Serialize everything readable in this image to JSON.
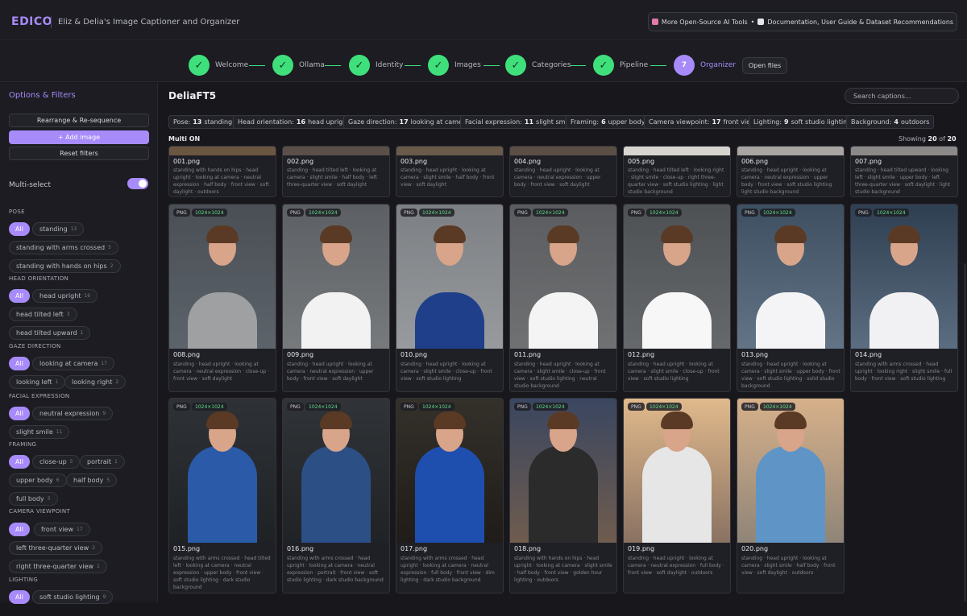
{
  "app": {
    "brand": "EDICO",
    "subtitle": "Eliz & Delia's Image Captioner and Organizer"
  },
  "top_link": {
    "part1": "More Open-Source AI Tools",
    "sep": "•",
    "part2": "Documentation, User Guide & Dataset Recommendations"
  },
  "steps": [
    {
      "label": "Welcome",
      "mark": "✓"
    },
    {
      "label": "Ollama",
      "mark": "✓"
    },
    {
      "label": "Identity",
      "mark": "✓"
    },
    {
      "label": "Images",
      "mark": "✓"
    },
    {
      "label": "Categories",
      "mark": "✓"
    },
    {
      "label": "Pipeline",
      "mark": "✓"
    },
    {
      "label": "Organizer",
      "mark": "7"
    }
  ],
  "open_files": "Open files",
  "sidebar": {
    "title": "Options & Filters",
    "rearrange": "Rearrange & Re-sequence",
    "add_image": "+ Add image",
    "reset": "Reset filters",
    "multiselect": "Multi-select",
    "sections": [
      {
        "title": "POSE",
        "chips": [
          {
            "label": "All"
          },
          {
            "label": "standing",
            "count": "13"
          },
          {
            "label": "standing with arms crossed",
            "count": "5"
          },
          {
            "label": "standing with hands on hips",
            "count": "2"
          }
        ]
      },
      {
        "title": "HEAD ORIENTATION",
        "chips": [
          {
            "label": "All"
          },
          {
            "label": "head upright",
            "count": "16"
          },
          {
            "label": "head tilted left",
            "count": "3"
          },
          {
            "label": "head tilted upward",
            "count": "1"
          }
        ]
      },
      {
        "title": "GAZE DIRECTION",
        "chips": [
          {
            "label": "All"
          },
          {
            "label": "looking at camera",
            "count": "17"
          },
          {
            "label": "looking left",
            "count": "1"
          },
          {
            "label": "looking right",
            "count": "2"
          }
        ]
      },
      {
        "title": "FACIAL EXPRESSION",
        "chips": [
          {
            "label": "All"
          },
          {
            "label": "neutral expression",
            "count": "9"
          },
          {
            "label": "slight smile",
            "count": "11"
          }
        ]
      },
      {
        "title": "FRAMING",
        "chips": [
          {
            "label": "All"
          },
          {
            "label": "close-up",
            "count": "5"
          },
          {
            "label": "portrait",
            "count": "1"
          },
          {
            "label": "upper body",
            "count": "6"
          },
          {
            "label": "half body",
            "count": "5"
          },
          {
            "label": "full body",
            "count": "3"
          }
        ]
      },
      {
        "title": "CAMERA VIEWPOINT",
        "chips": [
          {
            "label": "All"
          },
          {
            "label": "front view",
            "count": "17"
          },
          {
            "label": "left three-quarter view",
            "count": "2"
          },
          {
            "label": "right three-quarter view",
            "count": "1"
          }
        ]
      },
      {
        "title": "LIGHTING",
        "chips": [
          {
            "label": "All"
          },
          {
            "label": "soft studio lighting",
            "count": "9"
          }
        ]
      }
    ]
  },
  "main": {
    "folder": "DeliaFT5",
    "search_placeholder": "Search captions...",
    "multi_label": "Multi ON",
    "showing": {
      "prefix": "Showing",
      "count": "20",
      "of": "of",
      "total": "20"
    }
  },
  "filters": [
    {
      "key": "Pose:",
      "num": "13",
      "val": "standing"
    },
    {
      "key": "Head orientation:",
      "num": "16",
      "val": "head upright"
    },
    {
      "key": "Gaze direction:",
      "num": "17",
      "val": "looking at camera"
    },
    {
      "key": "Facial expression:",
      "num": "11",
      "val": "slight smile"
    },
    {
      "key": "Framing:",
      "num": "6",
      "val": "upper body"
    },
    {
      "key": "Camera viewpoint:",
      "num": "17",
      "val": "front view"
    },
    {
      "key": "Lighting:",
      "num": "9",
      "val": "soft studio lighting"
    },
    {
      "key": "Background:",
      "num": "4",
      "val": "outdoors"
    }
  ],
  "badges": {
    "format": "PNG",
    "resolution": "1024×1024"
  },
  "images": [
    {
      "name": "001.png",
      "caption": "standing with hands on hips · head upright · looking at camera · neutral expression · half body · front view · soft daylight · outdoors"
    },
    {
      "name": "002.png",
      "caption": "standing · head tilted left · looking at camera · slight smile · half body · left three-quarter view · soft daylight"
    },
    {
      "name": "003.png",
      "caption": "standing · head upright · looking at camera · slight smile · half body · front view · soft daylight"
    },
    {
      "name": "004.png",
      "caption": "standing · head upright · looking at camera · neutral expression · upper body · front view · soft daylight"
    },
    {
      "name": "005.png",
      "caption": "standing · head tilted left · looking right · slight smile · close-up · right three-quarter view · soft studio lighting · light studio background"
    },
    {
      "name": "006.png",
      "caption": "standing · head upright · looking at camera · neutral expression · upper body · front view · soft studio lighting · light studio background"
    },
    {
      "name": "007.png",
      "caption": "standing · head tilted upward · looking left · slight smile · upper body · left three-quarter view · soft daylight · light studio background"
    },
    {
      "name": "008.png",
      "caption": "standing · head upright · looking at camera · neutral expression · close-up · front view · soft daylight"
    },
    {
      "name": "009.png",
      "caption": "standing · head upright · looking at camera · neutral expression · upper body · front view · soft daylight"
    },
    {
      "name": "010.png",
      "caption": "standing · head upright · looking at camera · slight smile · close-up · front view · soft studio lighting"
    },
    {
      "name": "011.png",
      "caption": "standing · head upright · looking at camera · slight smile · close-up · front view · soft studio lighting · neutral studio background"
    },
    {
      "name": "012.png",
      "caption": "standing · head upright · looking at camera · slight smile · close-up · front view · soft studio lighting"
    },
    {
      "name": "013.png",
      "caption": "standing · head upright · looking at camera · slight smile · upper body · front view · soft studio lighting · solid studio background"
    },
    {
      "name": "014.png",
      "caption": "standing with arms crossed · head upright · looking right · slight smile · full body · front view · soft studio lighting"
    },
    {
      "name": "015.png",
      "caption": "standing with arms crossed · head tilted left · looking at camera · neutral expression · upper body · front view · soft studio lighting · dark studio background"
    },
    {
      "name": "016.png",
      "caption": "standing with arms crossed · head upright · looking at camera · neutral expression · portrait · front view · soft studio lighting · dark studio background"
    },
    {
      "name": "017.png",
      "caption": "standing with arms crossed · head upright · looking at camera · neutral expression · full body · front view · dim lighting · dark studio background"
    },
    {
      "name": "018.png",
      "caption": "standing with hands on hips · head upright · looking at camera · slight smile · half body · front view · golden hour lighting · outdoors"
    },
    {
      "name": "019.png",
      "caption": "standing · head upright · looking at camera · neutral expression · full body · front view · soft daylight · outdoors"
    },
    {
      "name": "020.png",
      "caption": "standing · head upright · looking at camera · slight smile · half body · front view · soft daylight · outdoors"
    }
  ],
  "colors": {
    "accent": "#a78bfa",
    "success": "#3fe07b",
    "background": "#17171c",
    "panel": "#1c1c22"
  }
}
